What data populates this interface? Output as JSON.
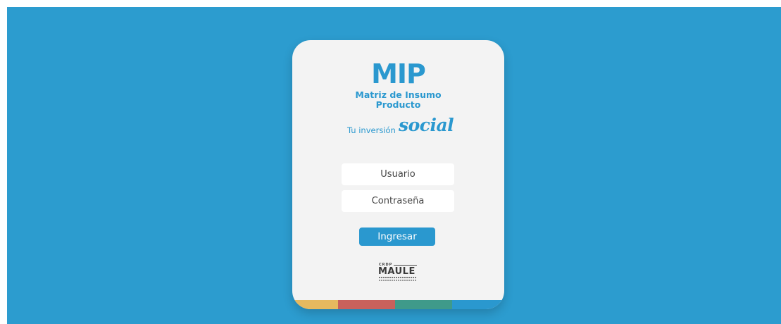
{
  "logo": {
    "acronym": "MIP",
    "subtitle_line1": "Matriz de Insumo",
    "subtitle_line2": "Producto"
  },
  "tagline": {
    "plain": "Tu inversión",
    "script": "social"
  },
  "form": {
    "username_placeholder": "Usuario",
    "password_placeholder": "Contraseña",
    "submit_label": "Ingresar"
  },
  "partner_logo": {
    "top": "CRDP",
    "main": "MAULE"
  },
  "colors": {
    "background": "#2c9ccf",
    "card": "#f3f3f3",
    "accent": "#2a98cf",
    "stripe": [
      "#e6b95f",
      "#c8615c",
      "#3f9a8a",
      "#2a98cf"
    ]
  }
}
